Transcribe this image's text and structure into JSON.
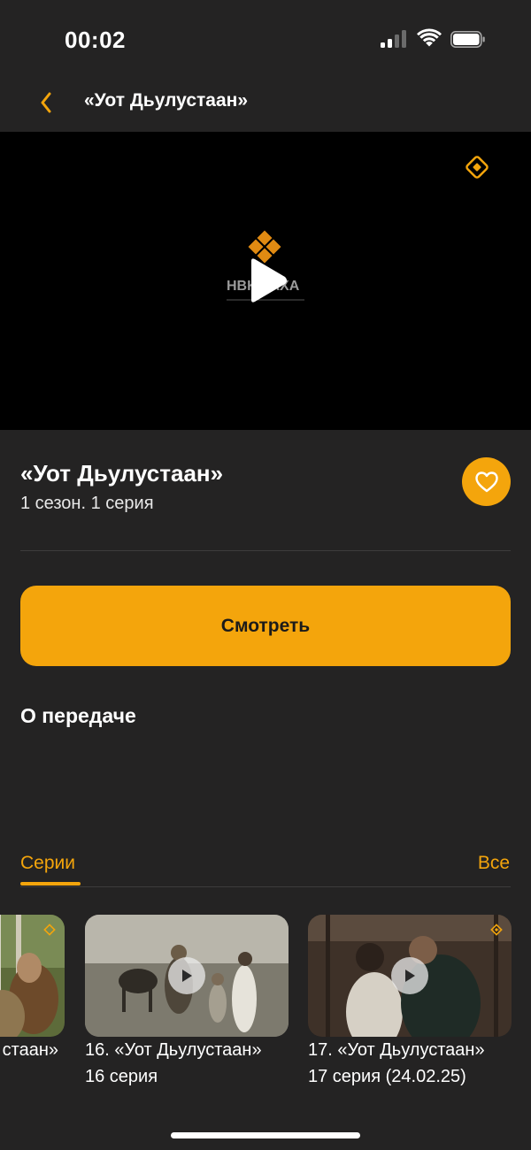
{
  "status_bar": {
    "time": "00:02"
  },
  "header": {
    "title": "«Уот Дьулустаан»"
  },
  "video": {
    "channel_logo_text": "НВК САХА"
  },
  "show": {
    "title": "«Уот Дьулустаан»",
    "subtitle": "1 сезон. 1 серия"
  },
  "actions": {
    "watch_label": "Смотреть"
  },
  "about": {
    "heading": "О передаче"
  },
  "tabs": {
    "series_label": "Серии",
    "all_label": "Все"
  },
  "episodes": [
    {
      "title": "стаан»",
      "subtitle": ""
    },
    {
      "title": "16. «Уот Дьулустаан»",
      "subtitle": "16 серия"
    },
    {
      "title": "17. «Уот Дьулустаан»",
      "subtitle": "17 серия (24.02.25)"
    }
  ],
  "colors": {
    "accent": "#f4a50c",
    "background": "#242323",
    "video_bg": "#000000"
  },
  "icons": [
    "back-chevron-icon",
    "live-diamond-icon",
    "play-icon",
    "heart-icon",
    "wifi-icon",
    "battery-icon",
    "signal-icon"
  ]
}
